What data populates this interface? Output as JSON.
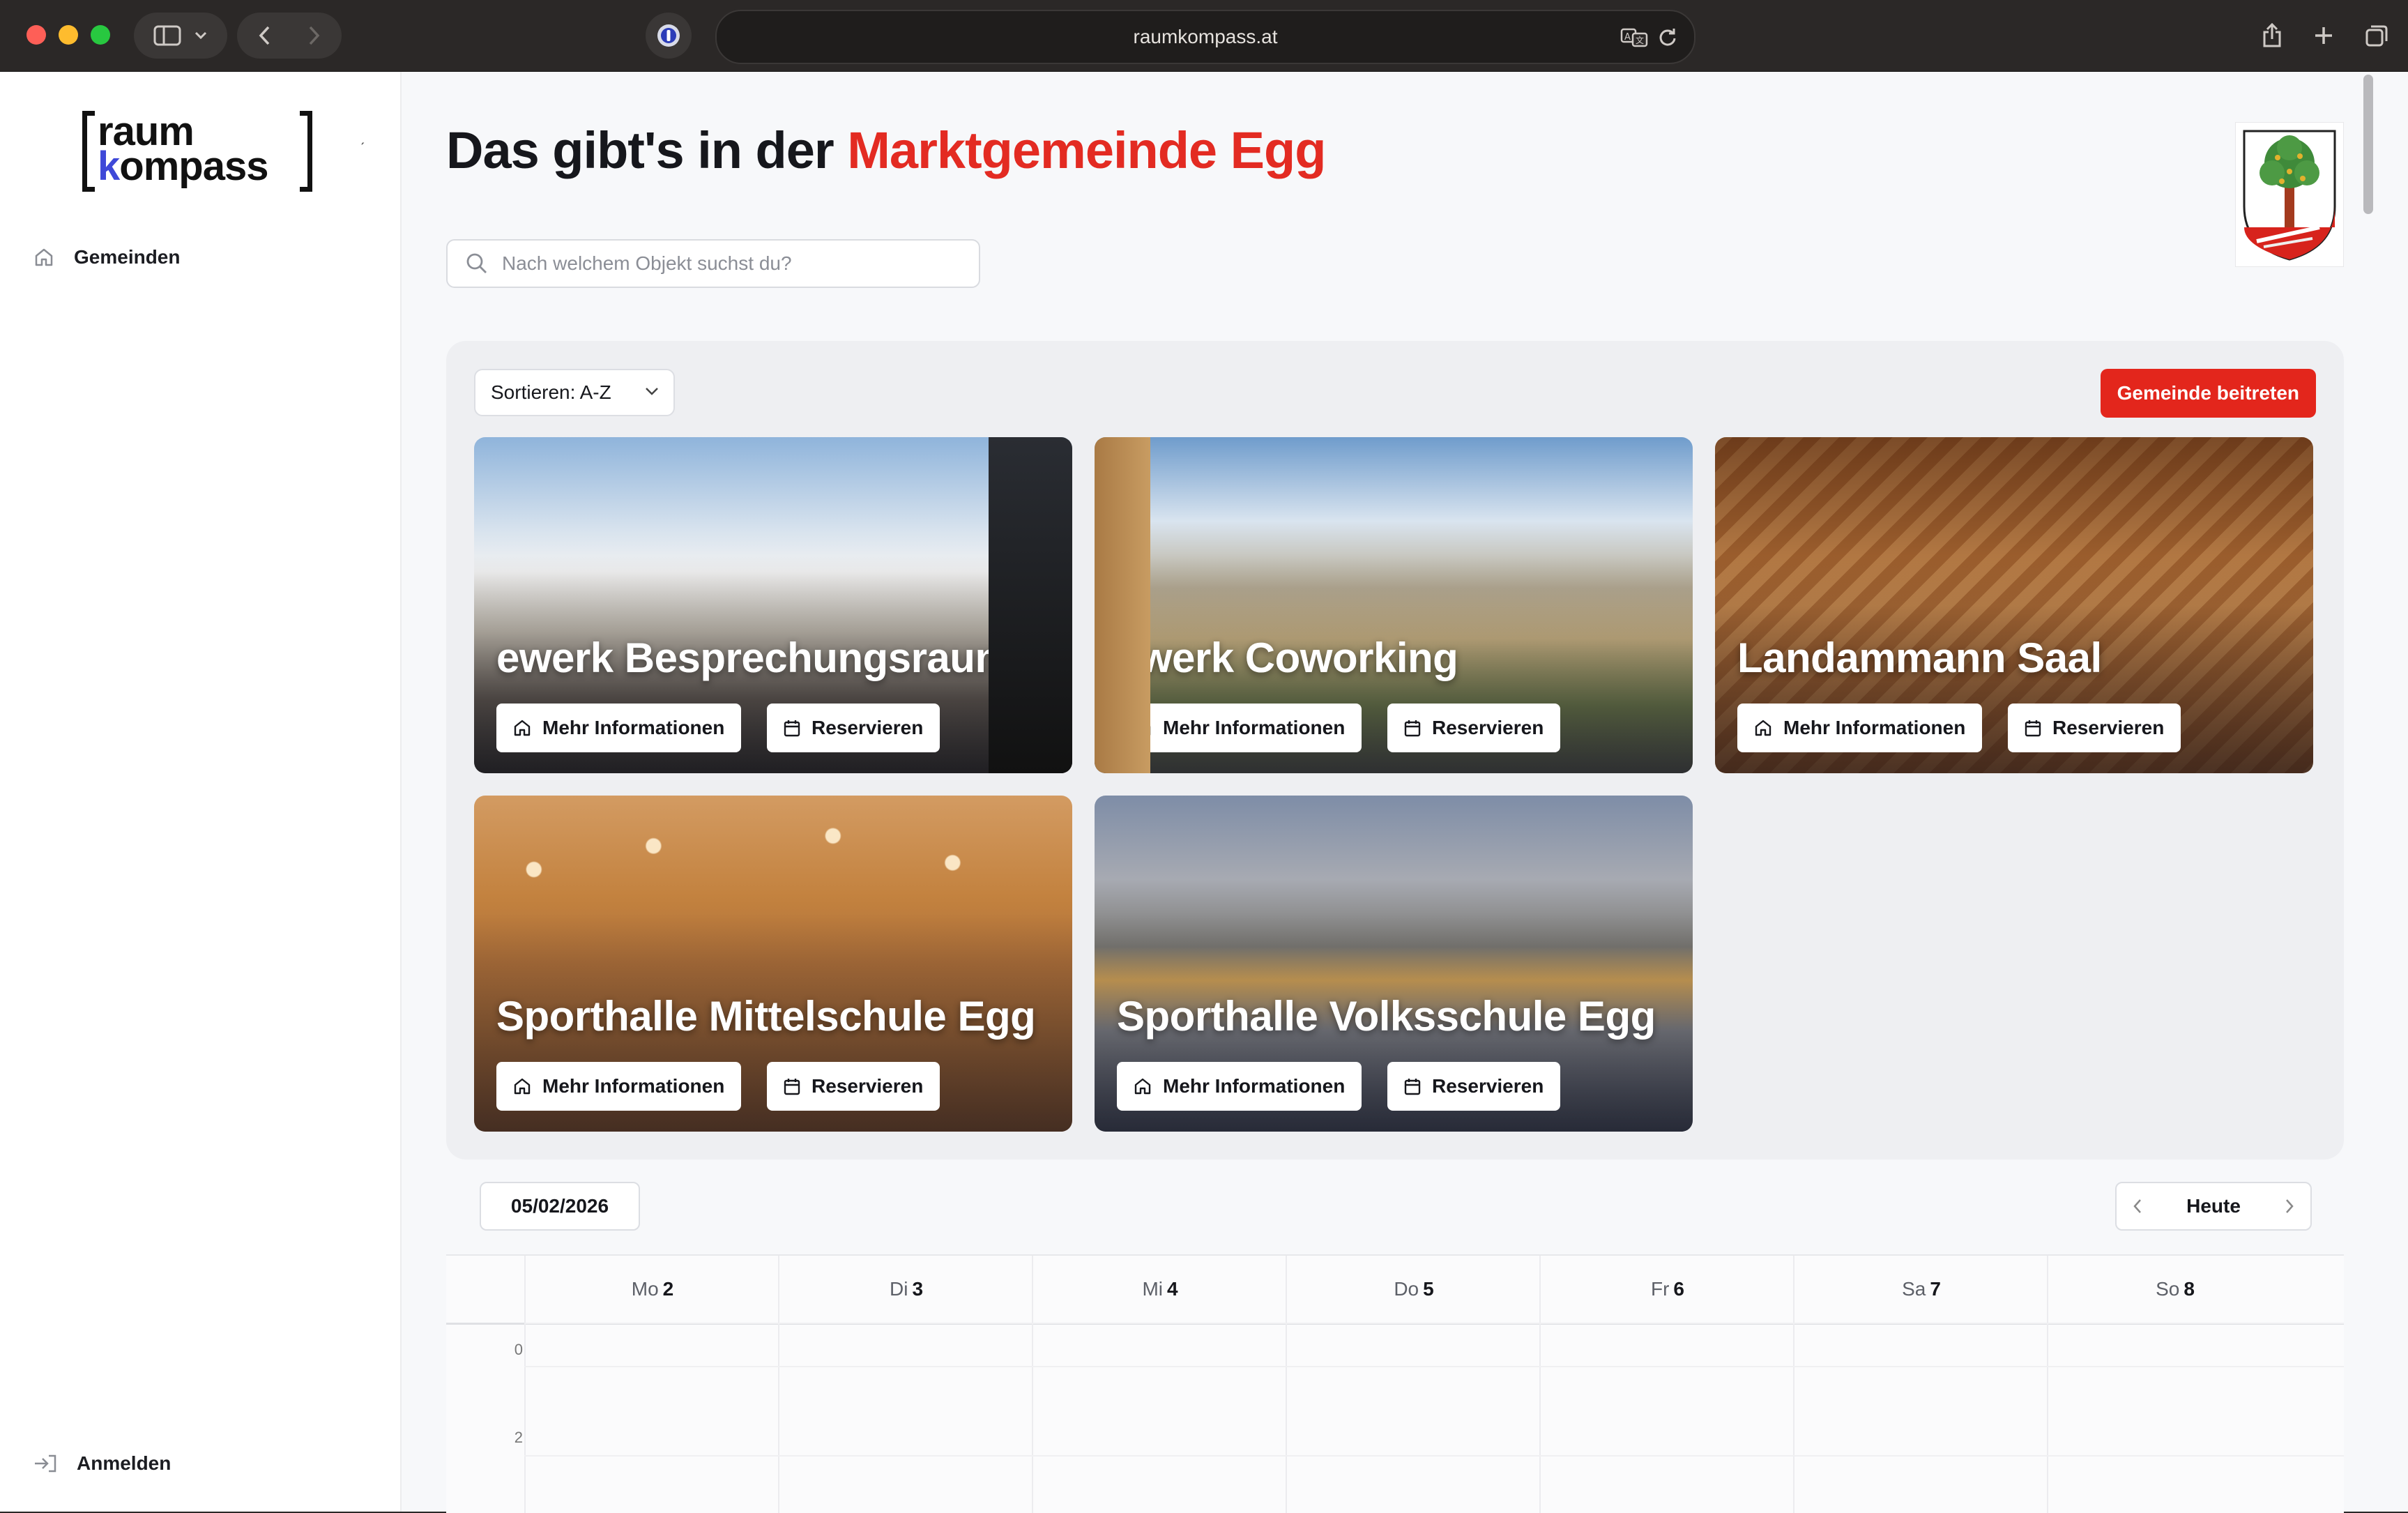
{
  "browser": {
    "url": "raumkompass.at"
  },
  "sidebar": {
    "logo": {
      "line1_pre": "r",
      "line1_accent": "",
      "line1_rest": "aum",
      "line2_accent": "k",
      "line2_rest": "ompass"
    },
    "items": [
      {
        "label": "Gemeinden",
        "icon": "home-icon"
      }
    ],
    "login_label": "Anmelden"
  },
  "header": {
    "title_prefix": "Das gibt's in der ",
    "title_highlight": "Marktgemeinde Egg"
  },
  "search": {
    "placeholder": "Nach welchem Objekt suchst du?"
  },
  "toolbar": {
    "sort_label": "Sortieren: A-Z",
    "join_label": "Gemeinde beitreten"
  },
  "cards": [
    {
      "name": "ewerk Besprechungsraum",
      "info_label": "Mehr Informationen",
      "reserve_label": "Reservieren"
    },
    {
      "name": "ewerk Coworking",
      "info_label": "Mehr Informationen",
      "reserve_label": "Reservieren"
    },
    {
      "name": "Landammann Saal",
      "info_label": "Mehr Informationen",
      "reserve_label": "Reservieren"
    },
    {
      "name": "Sporthalle Mittelschule Egg",
      "info_label": "Mehr Informationen",
      "reserve_label": "Reservieren"
    },
    {
      "name": "Sporthalle Volksschule Egg",
      "info_label": "Mehr Informationen",
      "reserve_label": "Reservieren"
    }
  ],
  "calendar": {
    "date": "05/02/2026",
    "today_label": "Heute",
    "days": [
      {
        "dow": "Mo",
        "num": "2"
      },
      {
        "dow": "Di",
        "num": "3"
      },
      {
        "dow": "Mi",
        "num": "4"
      },
      {
        "dow": "Do",
        "num": "5"
      },
      {
        "dow": "Fr",
        "num": "6"
      },
      {
        "dow": "Sa",
        "num": "7"
      },
      {
        "dow": "So",
        "num": "8"
      }
    ],
    "hours": [
      "0",
      "2"
    ]
  },
  "colors": {
    "accent": "#e3261c",
    "logo_accent": "#3e48d8"
  }
}
